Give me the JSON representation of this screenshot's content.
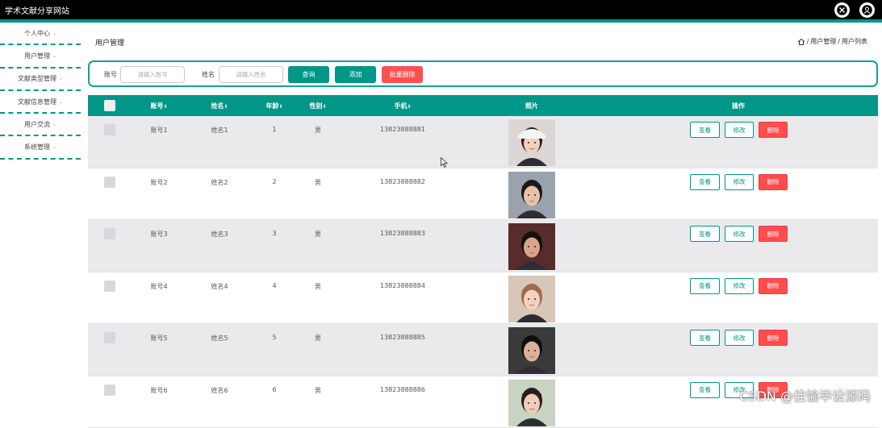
{
  "header": {
    "title": "学术文献分享网站",
    "colors": {
      "bar": "#000000",
      "accent": "#009688"
    },
    "icons": [
      "fullscreen-icon",
      "user-icon"
    ]
  },
  "sidebar": {
    "items": [
      {
        "label": "个人中心"
      },
      {
        "label": "用户管理"
      },
      {
        "label": "文献类型管理"
      },
      {
        "label": "文献信息管理"
      },
      {
        "label": "用户交流"
      },
      {
        "label": "系统管理"
      }
    ]
  },
  "page": {
    "title": "用户管理"
  },
  "breadcrumb": {
    "items": [
      "用户管理",
      "用户列表"
    ],
    "separator": "/"
  },
  "search": {
    "account_label": "账号",
    "account_placeholder": "请输入账号",
    "name_label": "姓名",
    "name_placeholder": "请输入姓名",
    "query_label": "查询",
    "add_label": "添加",
    "batch_delete_label": "批量删除"
  },
  "table": {
    "columns": [
      "账号",
      "姓名",
      "年龄",
      "性别",
      "手机",
      "照片",
      "操作"
    ],
    "sortable": [
      true,
      true,
      true,
      true,
      true,
      false,
      false
    ],
    "rows": [
      {
        "account": "账号1",
        "name": "姓名1",
        "age": "1",
        "gender": "男",
        "phone": "13823888881"
      },
      {
        "account": "账号2",
        "name": "姓名2",
        "age": "2",
        "gender": "男",
        "phone": "13823888882"
      },
      {
        "account": "账号3",
        "name": "姓名3",
        "age": "3",
        "gender": "男",
        "phone": "13823888883"
      },
      {
        "account": "账号4",
        "name": "姓名4",
        "age": "4",
        "gender": "男",
        "phone": "13823888884"
      },
      {
        "account": "账号5",
        "name": "姓名5",
        "age": "5",
        "gender": "男",
        "phone": "13823888885"
      },
      {
        "account": "账号6",
        "name": "姓名6",
        "age": "6",
        "gender": "男",
        "phone": "13823888886"
      }
    ],
    "actions": {
      "view": "查看",
      "edit": "修改",
      "delete": "删除"
    }
  },
  "watermark": "CSDN @佳愉毕设源码"
}
